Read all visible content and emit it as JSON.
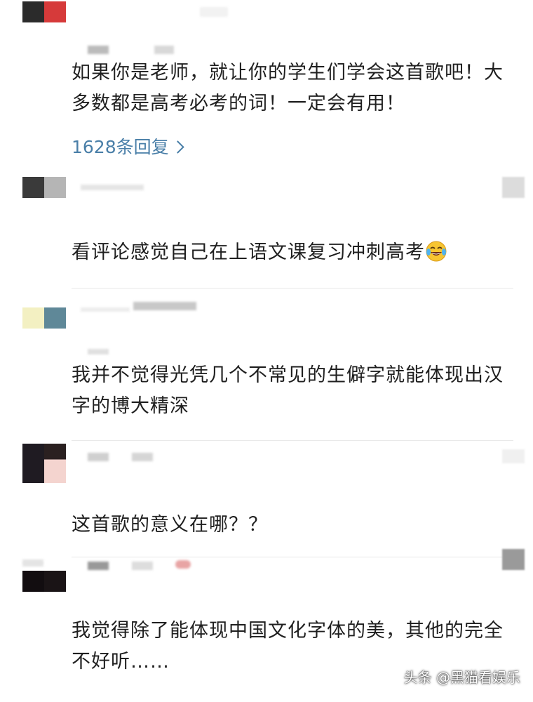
{
  "comments": [
    {
      "text": "如果你是老师，就让你的学生们学会这首歌吧！大多数都是高考必考的词！一定会有用！",
      "replies_label": "1628条回复"
    },
    {
      "text": "看评论感觉自己在上语文课复习冲刺高考",
      "emoji_icon": "tears-of-joy-emoji"
    },
    {
      "text": "我并不觉得光凭几个不常见的生僻字就能体现出汉字的博大精深"
    },
    {
      "text": "这首歌的意义在哪？？"
    },
    {
      "text": "我觉得除了能体现中国文化字体的美，其他的完全不好听……"
    }
  ],
  "watermark": "头条 @黑猫看娱乐",
  "colors": {
    "reply_link": "#4a7fa8",
    "text": "#1f1f1f",
    "divider": "#e9e9e9"
  }
}
